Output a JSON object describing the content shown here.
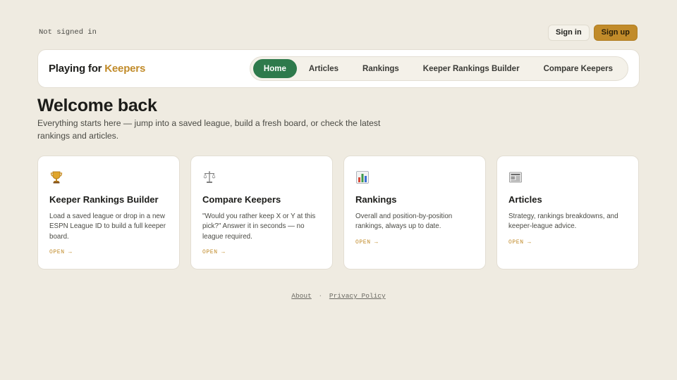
{
  "header": {
    "status": "Not signed in",
    "sign_in": "Sign in",
    "sign_up": "Sign up"
  },
  "brand": {
    "prefix": "Playing for",
    "accent": "Keepers"
  },
  "nav": {
    "tabs": [
      {
        "label": "Home",
        "active": true
      },
      {
        "label": "Articles"
      },
      {
        "label": "Rankings"
      },
      {
        "label": "Keeper Rankings Builder"
      },
      {
        "label": "Compare Keepers"
      }
    ]
  },
  "hero": {
    "title": "Welcome back",
    "subtitle": "Everything starts here — jump into a saved league, build a fresh board, or check the latest rankings and articles."
  },
  "cards": [
    {
      "icon": "trophy-icon",
      "title": "Keeper Rankings Builder",
      "description": "Load a saved league or drop in a new ESPN League ID to build a full keeper board.",
      "cta": "OPEN →"
    },
    {
      "icon": "scales-icon",
      "title": "Compare Keepers",
      "description": "\"Would you rather keep X or Y at this pick?\" Answer it in seconds — no league required.",
      "cta": "OPEN →"
    },
    {
      "icon": "bar-chart-icon",
      "title": "Rankings",
      "description": "Overall and position-by-position rankings, always up to date.",
      "cta": "OPEN →"
    },
    {
      "icon": "newspaper-icon",
      "title": "Articles",
      "description": "Strategy, rankings breakdowns, and keeper-league advice.",
      "cta": "OPEN →"
    }
  ],
  "footer": {
    "about": "About",
    "separator": "·",
    "privacy": "Privacy Policy"
  },
  "colors": {
    "background": "#efebe1",
    "accent_gold": "#c18b2a",
    "active_tab_green": "#2e7a4c"
  }
}
